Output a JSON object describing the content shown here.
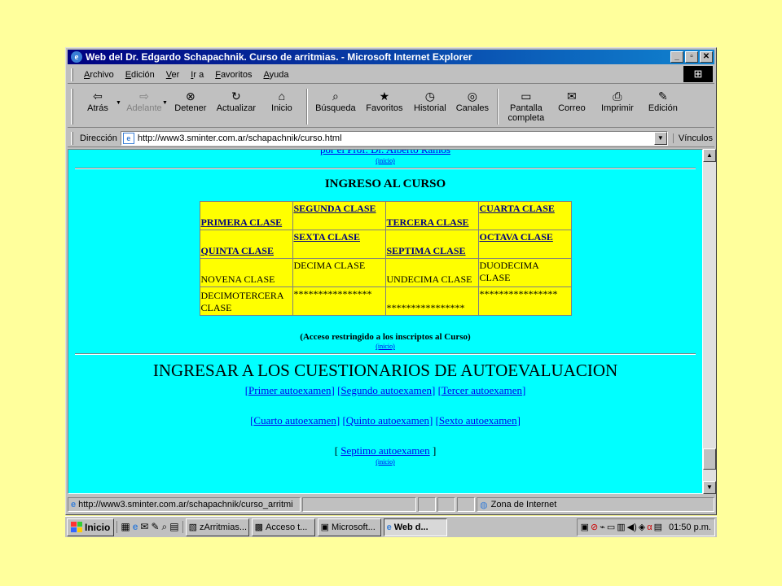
{
  "window": {
    "title": "Web del Dr. Edgardo Schapachnik. Curso de arritmias. - Microsoft Internet Explorer"
  },
  "menu": [
    "Archivo",
    "Edición",
    "Ver",
    "Ir a",
    "Favoritos",
    "Ayuda"
  ],
  "toolbar": {
    "back": "Atrás",
    "forward": "Adelante",
    "stop": "Detener",
    "refresh": "Actualizar",
    "home": "Inicio",
    "search": "Búsqueda",
    "favorites": "Favoritos",
    "history": "Historial",
    "channels": "Canales",
    "fullscreen_1": "Pantalla",
    "fullscreen_2": "completa",
    "mail": "Correo",
    "print": "Imprimir",
    "edit": "Edición"
  },
  "address": {
    "label": "Dirección",
    "url": "http://www3.sminter.com.ar/schapachnik/curso.html",
    "links": "Vínculos"
  },
  "content": {
    "top_link": "por el Prof. Dr. Alberto Ramos",
    "inicio": "(inicio)",
    "heading": "INGRESO AL CURSO",
    "rows": [
      [
        "PRIMERA CLASE",
        "SEGUNDA CLASE",
        "TERCERA CLASE",
        "CUARTA CLASE"
      ],
      [
        "QUINTA CLASE",
        "SEXTA CLASE",
        "SEPTIMA CLASE",
        "OCTAVA CLASE"
      ],
      [
        "NOVENA CLASE",
        "DECIMA CLASE",
        "UNDECIMA CLASE",
        "DUODECIMA CLASE"
      ],
      [
        "DECIMOTERCERA CLASE",
        "****************",
        "****************",
        "****************"
      ]
    ],
    "restricted": "(Acceso restringido a los inscriptos al Curso)",
    "quiz_heading": "INGRESAR A LOS CUESTIONARIOS DE AUTOEVALUACION",
    "quizzes": {
      "q1": "Primer autoexamen",
      "q2": "Segundo autoexamen",
      "q3": "Tercer autoexamen",
      "q4": "Cuarto autoexamen",
      "q5": "Quinto autoexamen",
      "q6": "Sexto autoexamen",
      "q7": "Septimo autoexamen"
    }
  },
  "status": {
    "url": "http://www3.sminter.com.ar/schapachnik/curso_arritmi",
    "zone": "Zona de Internet"
  },
  "taskbar": {
    "start": "Inicio",
    "tasks": [
      "zArritmias...",
      "Acceso t...",
      "Microsoft...",
      "Web d..."
    ],
    "clock": "01:50 p.m."
  }
}
